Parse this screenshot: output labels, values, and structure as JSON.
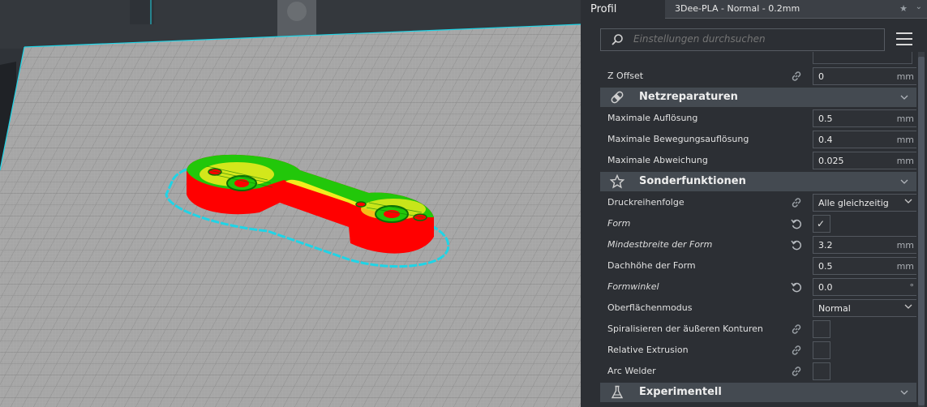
{
  "header": {
    "profile_label": "Profil",
    "profile_value": "3Dee-PLA - Normal - 0.2mm",
    "star_icon": "star-icon",
    "chevron_icon": "chevron-down-icon"
  },
  "search": {
    "placeholder": "Einstellungen durchsuchen",
    "icon": "search-icon",
    "menu_icon": "hamburger-menu-icon"
  },
  "settings": {
    "z_offset": {
      "label": "Z Offset",
      "value": "0",
      "unit": "mm"
    },
    "netzreparaturen": {
      "title": "Netzreparaturen",
      "icon": "bandage-icon",
      "items": [
        {
          "label": "Maximale Auflösung",
          "value": "0.5",
          "unit": "mm"
        },
        {
          "label": "Maximale Bewegungsauflösung",
          "value": "0.4",
          "unit": "mm"
        },
        {
          "label": "Maximale Abweichung",
          "value": "0.025",
          "unit": "mm"
        }
      ]
    },
    "sonderfunktionen": {
      "title": "Sonderfunktionen",
      "icon": "star-outline-icon",
      "druckreihenfolge": {
        "label": "Druckreihenfolge",
        "value": "Alle gleichzeitig"
      },
      "form": {
        "label": "Form",
        "checked": true,
        "check_glyph": "✓"
      },
      "mindestbreite": {
        "label": "Mindestbreite der Form",
        "value": "3.2",
        "unit": "mm"
      },
      "dachhoehe": {
        "label": "Dachhöhe der Form",
        "value": "0.5",
        "unit": "mm"
      },
      "formwinkel": {
        "label": "Formwinkel",
        "value": "0.0",
        "unit": "°"
      },
      "oberflaechenmodus": {
        "label": "Oberflächenmodus",
        "value": "Normal"
      },
      "spiralisieren": {
        "label": "Spiralisieren der äußeren Konturen",
        "checked": false
      },
      "relative_extrusion": {
        "label": "Relative Extrusion",
        "checked": false
      },
      "arc_welder": {
        "label": "Arc Welder",
        "checked": false
      }
    },
    "experimentell": {
      "title": "Experimentell",
      "icon": "flask-icon"
    }
  },
  "colors": {
    "model_red": "#ff0000",
    "model_green": "#22c70a",
    "model_yellow": "#f2ec1e",
    "skirt_cyan": "#1fd4e6",
    "build_plate": "#9a9a9a",
    "category_bg": "#444a51"
  }
}
